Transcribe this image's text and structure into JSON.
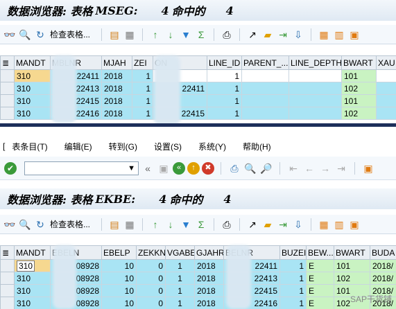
{
  "top_window": {
    "title": {
      "prefix": "数据浏览器: 表格",
      "table": "MSEG:",
      "count": "4",
      "suffix": "命中的",
      "count2": "4"
    },
    "toolbar": {
      "check_table_label": "检查表格..."
    },
    "columns": [
      "MANDT",
      "MBLNR",
      "MJAH",
      "ZEI",
      "ON",
      "LINE_ID",
      "PARENT_...",
      "LINE_DEPTH",
      "BWART",
      "XAU"
    ],
    "rows": [
      {
        "mandt": "310",
        "mblnr": "22411",
        "mjahr": "2018",
        "zeile": "1",
        "obj": "",
        "line_id": "1",
        "parent": "",
        "line_depth": "",
        "bwart": "101"
      },
      {
        "mandt": "310",
        "mblnr": "22413",
        "mjahr": "2018",
        "zeile": "1",
        "obj": "22411",
        "line_id": "1",
        "parent": "",
        "line_depth": "",
        "bwart": "102"
      },
      {
        "mandt": "310",
        "mblnr": "22415",
        "mjahr": "2018",
        "zeile": "1",
        "obj": "",
        "line_id": "1",
        "parent": "",
        "line_depth": "",
        "bwart": "101"
      },
      {
        "mandt": "310",
        "mblnr": "22416",
        "mjahr": "2018",
        "zeile": "1",
        "obj": "22415",
        "line_id": "1",
        "parent": "",
        "line_depth": "",
        "bwart": "102"
      }
    ]
  },
  "menubar": {
    "prefix": "[",
    "items": [
      "表条目(T)",
      "编辑(E)",
      "转到(G)",
      "设置(S)",
      "系统(Y)",
      "帮助(H)"
    ]
  },
  "bottom_window": {
    "title": {
      "prefix": "数据浏览器: 表格",
      "table": "EKBE:",
      "count": "4",
      "suffix": "命中的",
      "count2": "4"
    },
    "toolbar": {
      "check_table_label": "检查表格..."
    },
    "columns": [
      "MANDT",
      "EBELN",
      "EBELP",
      "ZEKKN",
      "VGABE",
      "GJAHR",
      "BELNR",
      "BUZEI",
      "BEW...",
      "BWART",
      "BUDA"
    ],
    "rows": [
      {
        "mandt": "310",
        "ebeln": "08928",
        "ebelp": "10",
        "zekkn": "0",
        "vgabe": "1",
        "gjahr": "2018",
        "belnr": "22411",
        "buzei": "1",
        "bewtp": "E",
        "bwart": "101",
        "budat": "2018/"
      },
      {
        "mandt": "310",
        "ebeln": "08928",
        "ebelp": "10",
        "zekkn": "0",
        "vgabe": "1",
        "gjahr": "2018",
        "belnr": "22413",
        "buzei": "1",
        "bewtp": "E",
        "bwart": "102",
        "budat": "2018/"
      },
      {
        "mandt": "310",
        "ebeln": "08928",
        "ebelp": "10",
        "zekkn": "0",
        "vgabe": "1",
        "gjahr": "2018",
        "belnr": "22415",
        "buzei": "1",
        "bewtp": "E",
        "bwart": "101",
        "budat": "2018/"
      },
      {
        "mandt": "310",
        "ebeln": "08928",
        "ebelp": "10",
        "zekkn": "0",
        "vgabe": "1",
        "gjahr": "2018",
        "belnr": "22416",
        "buzei": "1",
        "bewtp": "E",
        "bwart": "102",
        "budat": "2018/"
      }
    ]
  },
  "watermark": "SAP干货铺",
  "colors": {
    "cell_blue": "#a9e4f4",
    "cell_green": "#c9f3c2",
    "header_bg": "#e9eef3",
    "divider": "#1d2f5a"
  }
}
